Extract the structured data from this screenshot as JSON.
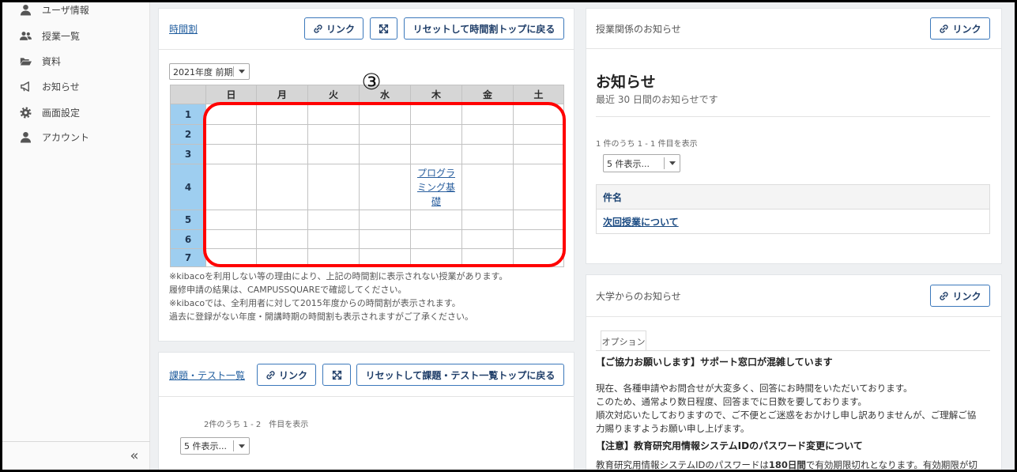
{
  "sidebar": {
    "items": [
      {
        "label": "ユーザ情報",
        "icon": "user-icon"
      },
      {
        "label": "授業一覧",
        "icon": "users-icon"
      },
      {
        "label": "資料",
        "icon": "folder-icon"
      },
      {
        "label": "お知らせ",
        "icon": "bullhorn-icon"
      },
      {
        "label": "画面設定",
        "icon": "gear-icon"
      },
      {
        "label": "アカウント",
        "icon": "user-icon"
      }
    ],
    "collapse_label": "«"
  },
  "timetable_panel": {
    "title": "時間割",
    "link_button": "リンク",
    "expand_icon": "expand-icon",
    "reset_button": "リセットして時間割トップに戻る",
    "term_select": "2021年度 前期",
    "days": [
      "日",
      "月",
      "火",
      "水",
      "木",
      "金",
      "土"
    ],
    "periods": [
      "1",
      "2",
      "3",
      "4",
      "5",
      "6",
      "7"
    ],
    "courses": [
      {
        "period": "4",
        "day": "木",
        "name": "プログラミング基礎"
      }
    ],
    "notes": [
      "※kibacoを利用しない等の理由により、上記の時間割に表示されない授業があります。",
      "履修申請の結果は、CAMPUSSQUAREで確認してください。",
      "※kibacoでは、全利用者に対して2015年度からの時間割が表示されます。",
      "過去に登録がない年度・開講時期の時間割も表示されますがご了承ください。"
    ]
  },
  "annotation": {
    "marker": "③",
    "highlight_color": "#ff0000"
  },
  "assignments_panel": {
    "title": "課題・テスト一覧",
    "link_button": "リンク",
    "reset_button": "リセットして課題・テスト一覧トップに戻る",
    "count_text": "2件のうち 1 - 2　件目を表示",
    "page_size_select": "5 件表示..."
  },
  "course_notices_panel": {
    "title": "授業関係のお知らせ",
    "link_button": "リンク",
    "heading": "お知らせ",
    "subheading": "最近 30 日間のお知らせです",
    "count_text": "1 件のうち 1 - 1 件目を表示",
    "page_size_select": "5 件表示...",
    "table_header": "件名",
    "rows": [
      "次回授業について"
    ]
  },
  "university_notices_panel": {
    "title": "大学からのお知らせ",
    "link_button": "リンク",
    "tab": "オプション",
    "items": [
      {
        "title": "【ご協力お願いします】サポート窓口が混雑しています",
        "body_lines": [
          "現在、各種申請やお問合せが大変多く、回答にお時間をいただいております。",
          "このため、通常より数日程度、回答までに日数を要しております。",
          "順次対応いたしておりますので、ご不便とご迷惑をおかけし申し訳ありませんが、ご理解ご協",
          "力賜りますようお願い申し上げます。"
        ]
      },
      {
        "title": "【注意】教育研究用情報システムIDのパスワード変更について",
        "body_before": "教育研究用情報システムIDのパスワードは",
        "body_emphasis": "180日間",
        "body_after": "で有効期限切れとなります。有効期限が切"
      }
    ]
  },
  "colors": {
    "link": "#205d9e",
    "button_border": "#3b78bb",
    "period_cell": "#9ecef0",
    "header_cell": "#d6d6d6"
  }
}
